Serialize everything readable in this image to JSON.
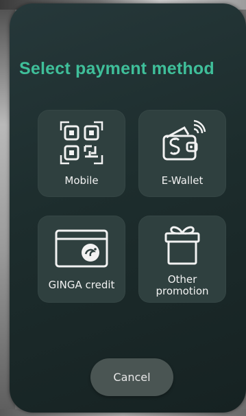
{
  "dialog": {
    "title": "Select payment method",
    "options": [
      {
        "label": "Mobile",
        "icon": "qr-code-icon"
      },
      {
        "label": "E-Wallet",
        "icon": "wallet-icon"
      },
      {
        "label": "GINGA credit",
        "icon": "credit-card-icon"
      },
      {
        "label_line1": "Other",
        "label_line2": "promotion",
        "icon": "gift-icon"
      }
    ],
    "cancel_label": "Cancel"
  },
  "colors": {
    "title": "#3fbf9a",
    "panel": "#1d2d2d",
    "card": "#2f403f",
    "cancel_button": "#4a5553"
  }
}
